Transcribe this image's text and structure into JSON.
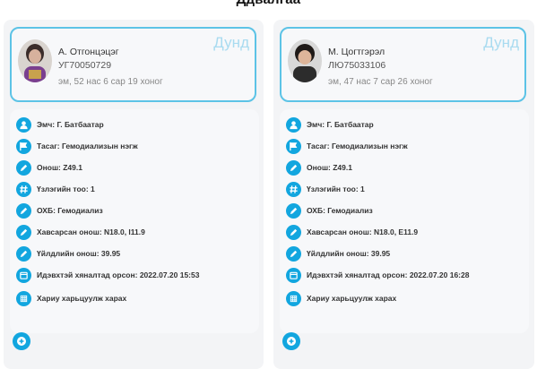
{
  "header": {
    "title": "Ддвалгаа"
  },
  "patients": [
    {
      "name": "А. Отгонцэцэг",
      "id": "УГ70050729",
      "age": "эм, 52 нас 6 сар 19 хоног",
      "level": "Дунд",
      "info": [
        {
          "icon": "user-icon",
          "text": "Эмч: Г. Батбаатар"
        },
        {
          "icon": "flag-icon",
          "text": "Тасаг: Гемодиализын нэгж"
        },
        {
          "icon": "pencil-icon",
          "text": "Онош: Z49.1"
        },
        {
          "icon": "hash-icon",
          "text": "Үзлэгийн тоо: 1"
        },
        {
          "icon": "pencil-icon",
          "text": "ОХБ: Гемодиализ"
        },
        {
          "icon": "pencil-icon",
          "text": "Хавсарсан онош: N18.0, I11.9"
        },
        {
          "icon": "pencil-icon",
          "text": "Үйлдлийн онош: 39.95"
        },
        {
          "icon": "calendar-icon",
          "text": "Идэвхтэй хяналтад орсон: 2022.07.20 15:53"
        },
        {
          "icon": "grid-icon",
          "text": "Хариу харьцуулж харах"
        }
      ]
    },
    {
      "name": "М. Цогтгэрэл",
      "id": "ЛЮ75033106",
      "age": "эм, 47 нас 7 сар 26 хоног",
      "level": "Дунд",
      "info": [
        {
          "icon": "user-icon",
          "text": "Эмч: Г. Батбаатар"
        },
        {
          "icon": "flag-icon",
          "text": "Тасаг: Гемодиализын нэгж"
        },
        {
          "icon": "pencil-icon",
          "text": "Онош: Z49.1"
        },
        {
          "icon": "hash-icon",
          "text": "Үзлэгийн тоо: 1"
        },
        {
          "icon": "pencil-icon",
          "text": "ОХБ: Гемодиализ"
        },
        {
          "icon": "pencil-icon",
          "text": "Хавсарсан онош: N18.0, E11.9"
        },
        {
          "icon": "pencil-icon",
          "text": "Үйлдлийн онош: 39.95"
        },
        {
          "icon": "calendar-icon",
          "text": "Идэвхтэй хяналтад орсон: 2022.07.20 16:28"
        },
        {
          "icon": "grid-icon",
          "text": "Хариу харьцуулж харах"
        }
      ]
    }
  ],
  "colors": {
    "accent": "#12a6df",
    "card_border": "#5cc3e6",
    "level_text": "#a9dbf0"
  }
}
